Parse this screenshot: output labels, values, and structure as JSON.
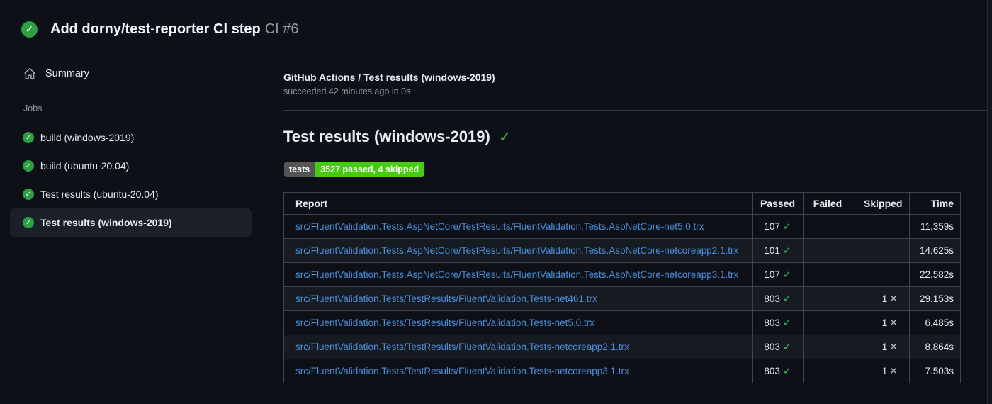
{
  "run_header": {
    "title": "Add dorny/test-reporter CI step",
    "run_number": "CI #6"
  },
  "sidebar": {
    "summary_label": "Summary",
    "jobs_heading": "Jobs",
    "jobs": [
      {
        "label": "build (windows-2019)",
        "status": "success",
        "selected": false
      },
      {
        "label": "build (ubuntu-20.04)",
        "status": "success",
        "selected": false
      },
      {
        "label": "Test results (ubuntu-20.04)",
        "status": "success",
        "selected": false
      },
      {
        "label": "Test results (windows-2019)",
        "status": "success",
        "selected": true
      }
    ]
  },
  "main": {
    "breadcrumb_title": "GitHub Actions / Test results (windows-2019)",
    "status_line": "succeeded 42 minutes ago in 0s",
    "section_title": "Test results (windows-2019)",
    "badge": {
      "label": "tests",
      "value": "3527 passed, 4 skipped",
      "label_bg": "#555555",
      "value_bg": "#44cc11"
    },
    "table": {
      "headers": [
        "Report",
        "Passed",
        "Failed",
        "Skipped",
        "Time"
      ],
      "column_keys": [
        "report",
        "passed",
        "failed",
        "skipped",
        "time"
      ],
      "rows": [
        {
          "report": "src/FluentValidation.Tests.AspNetCore/TestResults/FluentValidation.Tests.AspNetCore-net5.0.trx",
          "passed": "107",
          "failed": "",
          "skipped": "",
          "time": "11.359s"
        },
        {
          "report": "src/FluentValidation.Tests.AspNetCore/TestResults/FluentValidation.Tests.AspNetCore-netcoreapp2.1.trx",
          "passed": "101",
          "failed": "",
          "skipped": "",
          "time": "14.625s"
        },
        {
          "report": "src/FluentValidation.Tests.AspNetCore/TestResults/FluentValidation.Tests.AspNetCore-netcoreapp3.1.trx",
          "passed": "107",
          "failed": "",
          "skipped": "",
          "time": "22.582s"
        },
        {
          "report": "src/FluentValidation.Tests/TestResults/FluentValidation.Tests-net461.trx",
          "passed": "803",
          "failed": "",
          "skipped": "1",
          "time": "29.153s"
        },
        {
          "report": "src/FluentValidation.Tests/TestResults/FluentValidation.Tests-net5.0.trx",
          "passed": "803",
          "failed": "",
          "skipped": "1",
          "time": "6.485s"
        },
        {
          "report": "src/FluentValidation.Tests/TestResults/FluentValidation.Tests-netcoreapp2.1.trx",
          "passed": "803",
          "failed": "",
          "skipped": "1",
          "time": "8.864s"
        },
        {
          "report": "src/FluentValidation.Tests/TestResults/FluentValidation.Tests-netcoreapp3.1.trx",
          "passed": "803",
          "failed": "",
          "skipped": "1",
          "time": "7.503s"
        }
      ]
    }
  },
  "icons": {
    "success_check": "✓",
    "skipped_x": "✕"
  },
  "colors": {
    "background": "#0d1117",
    "row_alt": "#161b22",
    "border": "#3d444d",
    "link_blue": "#4a8fd9",
    "success_green": "#2ea043",
    "check_green": "#3fb950",
    "text_secondary": "#9198a1"
  }
}
